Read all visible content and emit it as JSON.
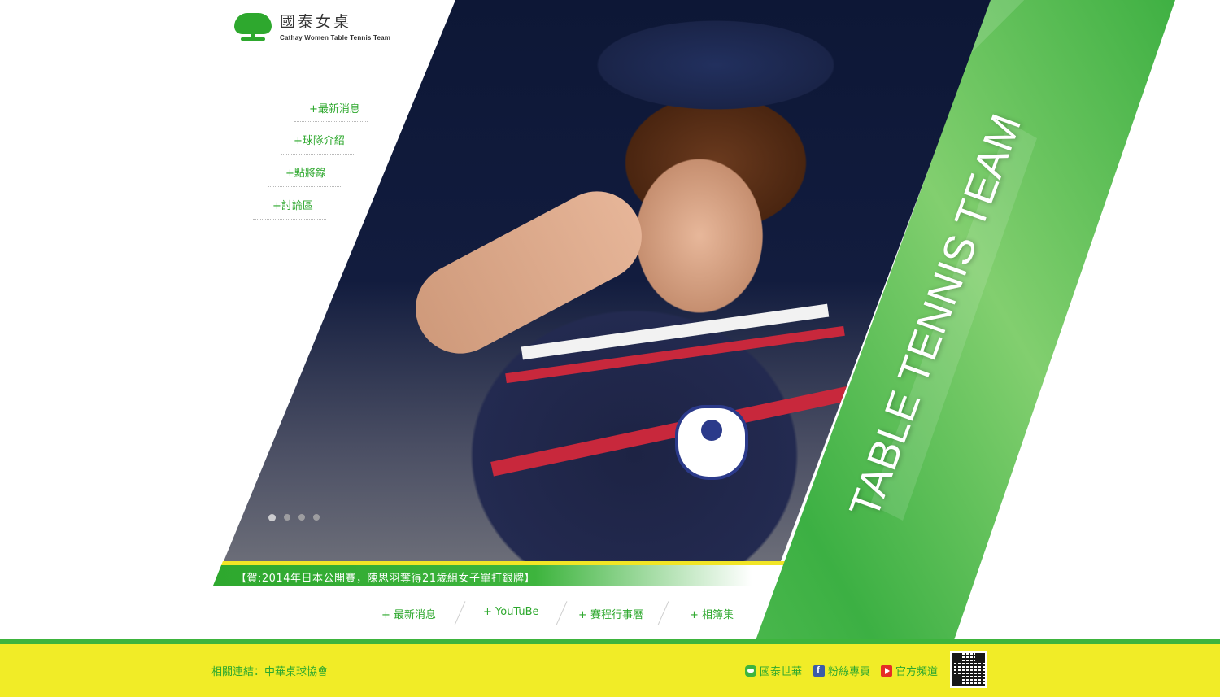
{
  "logo": {
    "title": "國泰女桌",
    "subtitle": "Cathay Women Table Tennis Team",
    "icon": "cathay-tree-icon"
  },
  "side_nav": {
    "items": [
      {
        "label": "+最新消息"
      },
      {
        "label": "+球隊介紹"
      },
      {
        "label": "+點將錄"
      },
      {
        "label": "+討論區"
      }
    ]
  },
  "hero": {
    "slide_count": 4,
    "active_slide": 1,
    "band_text": "TABLE TENNIS TEAM"
  },
  "ticker": {
    "text": "【賀:2014年日本公開賽，陳思羽奪得21歲組女子單打銀牌】"
  },
  "bottom_nav": {
    "items": [
      {
        "label": "+ 最新消息"
      },
      {
        "label": "+ YouTuBe"
      },
      {
        "label": "+ 賽程行事曆"
      },
      {
        "label": "+ 相簿集"
      }
    ]
  },
  "footer": {
    "related_links": "相關連結：中華桌球協會",
    "social": [
      {
        "label": "國泰世華",
        "icon": "line-icon"
      },
      {
        "label": "粉絲專頁",
        "icon": "facebook-icon"
      },
      {
        "label": "官方頻道",
        "icon": "youtube-icon"
      }
    ],
    "qr_icon": "qr-code-icon"
  },
  "colors": {
    "brand_green": "#2ea82e",
    "accent_yellow": "#f1ec27",
    "band_green": "#3cb043"
  }
}
